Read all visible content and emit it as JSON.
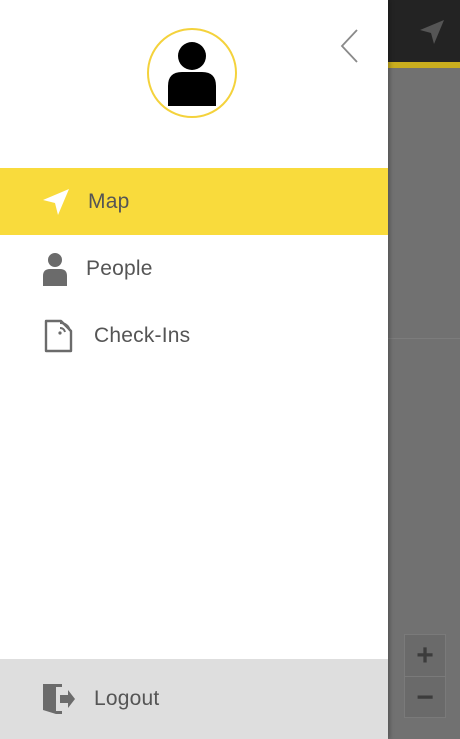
{
  "drawer": {
    "menu": [
      {
        "label": "Map",
        "icon": "navigation-arrow-icon",
        "active": true
      },
      {
        "label": "People",
        "icon": "person-icon",
        "active": false
      },
      {
        "label": "Check-Ins",
        "icon": "document-signal-icon",
        "active": false
      }
    ],
    "logout": {
      "label": "Logout",
      "icon": "logout-door-icon"
    }
  },
  "map_controls": {
    "zoom_in": "+",
    "zoom_out": "−"
  },
  "colors": {
    "accent": "#f9db3c",
    "avatar_ring": "#f4d23c",
    "text": "#555555",
    "icon": "#666666",
    "logout_bg": "#dedede"
  }
}
